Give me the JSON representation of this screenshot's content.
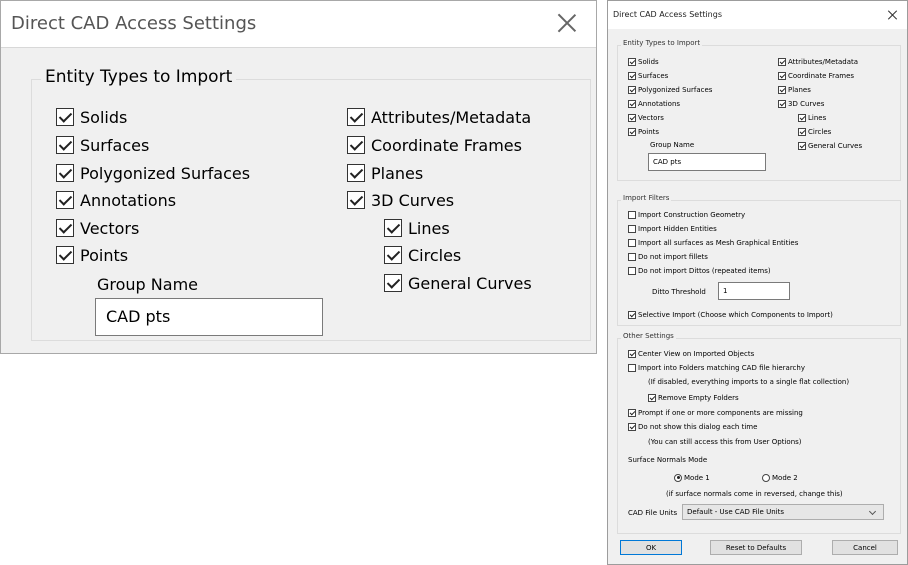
{
  "zoom": {
    "title": "Direct CAD Access Settings",
    "group_legend": "Entity Types to Import",
    "left_items": [
      "Solids",
      "Surfaces",
      "Polygonized Surfaces",
      "Annotations",
      "Vectors",
      "Points"
    ],
    "right_items": [
      "Attributes/Metadata",
      "Coordinate Frames",
      "Planes",
      "3D Curves"
    ],
    "sub_items": [
      "Lines",
      "Circles",
      "General Curves"
    ],
    "group_name_label": "Group Name",
    "group_name_value": "CAD pts"
  },
  "dialog": {
    "title": "Direct CAD Access Settings",
    "entity_types": {
      "legend": "Entity Types to Import",
      "left_items": [
        "Solids",
        "Surfaces",
        "Polygonized Surfaces",
        "Annotations",
        "Vectors",
        "Points"
      ],
      "right_items": [
        "Attributes/Metadata",
        "Coordinate Frames",
        "Planes",
        "3D Curves"
      ],
      "sub_items": [
        "Lines",
        "Circles",
        "General Curves"
      ],
      "group_name_label": "Group Name",
      "group_name_value": "CAD pts"
    },
    "import_filters": {
      "legend": "Import Filters",
      "items": [
        {
          "label": "Import Construction Geometry",
          "checked": false
        },
        {
          "label": "Import Hidden Entities",
          "checked": false
        },
        {
          "label": "Import all surfaces as Mesh Graphical Entities",
          "checked": false
        },
        {
          "label": "Do not import fillets",
          "checked": false
        },
        {
          "label": "Do not import Dittos (repeated items)",
          "checked": false
        }
      ],
      "ditto_label": "Ditto Threshold",
      "ditto_value": "1",
      "selective_label": "Selective Import (Choose which Components to Import)"
    },
    "other_settings": {
      "legend": "Other Settings",
      "center_view": "Center View on Imported Objects",
      "import_folders": "Import into Folders matching CAD file hierarchy",
      "folders_note": "(If disabled, everything imports to a single flat collection)",
      "remove_empty": "Remove Empty Folders",
      "prompt_missing": "Prompt if one or more components are missing",
      "do_not_show": "Do not show this dialog each time",
      "still_access": "(You can still access this from User Options)",
      "normals_label": "Surface Normals Mode",
      "mode1": "Mode 1",
      "mode2": "Mode 2",
      "normals_note": "(if surface normals come in reversed, change this)",
      "units_label": "CAD File Units",
      "units_value": "Default - Use CAD File Units"
    },
    "buttons": {
      "ok": "OK",
      "reset": "Reset to Defaults",
      "cancel": "Cancel"
    }
  }
}
